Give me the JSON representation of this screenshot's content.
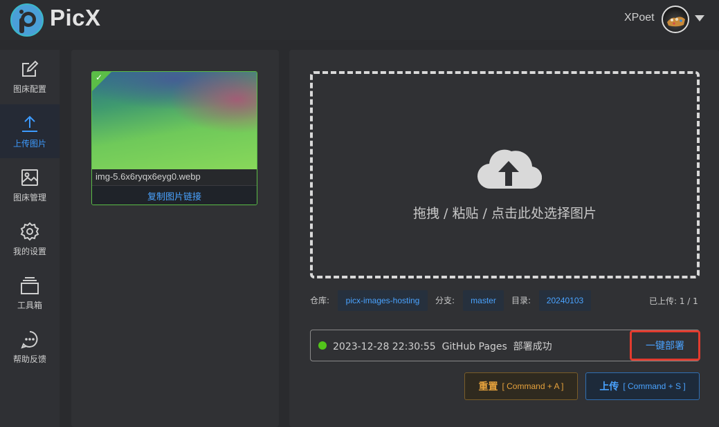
{
  "app": {
    "brand": "PicX",
    "user_name": "XPoet"
  },
  "colors": {
    "accent": "#4aa3ff",
    "success": "#52c41a",
    "warning": "#e6a23c",
    "highlight_border": "#e23b2e"
  },
  "sidebar": {
    "items": [
      {
        "label": "图床配置",
        "icon": "edit-icon"
      },
      {
        "label": "上传图片",
        "icon": "upload-icon",
        "active": true
      },
      {
        "label": "图床管理",
        "icon": "image-icon"
      },
      {
        "label": "我的设置",
        "icon": "gear-icon"
      },
      {
        "label": "工具箱",
        "icon": "toolbox-icon"
      },
      {
        "label": "帮助反馈",
        "icon": "chat-icon"
      }
    ]
  },
  "image_card": {
    "file_name": "img-5.6x6ryqx6eyg0.webp",
    "copy_label": "复制图片链接",
    "check": "✓"
  },
  "upload": {
    "drop_text": "拖拽 / 粘贴 / 点击此处选择图片",
    "repo_label": "仓库:",
    "repo_value": "picx-images-hosting",
    "branch_label": "分支:",
    "branch_value": "master",
    "dir_label": "目录:",
    "dir_value": "20240103",
    "uploaded_text": "已上传: 1 / 1"
  },
  "deploy_status": {
    "text": "2023-12-28 22:30:55  GitHub Pages  部署成功",
    "deploy_button": "一键部署"
  },
  "actions": {
    "reset_label": "重置",
    "reset_shortcut": "[ Command + A ]",
    "upload_label": "上传",
    "upload_shortcut": "[ Command + S ]"
  }
}
